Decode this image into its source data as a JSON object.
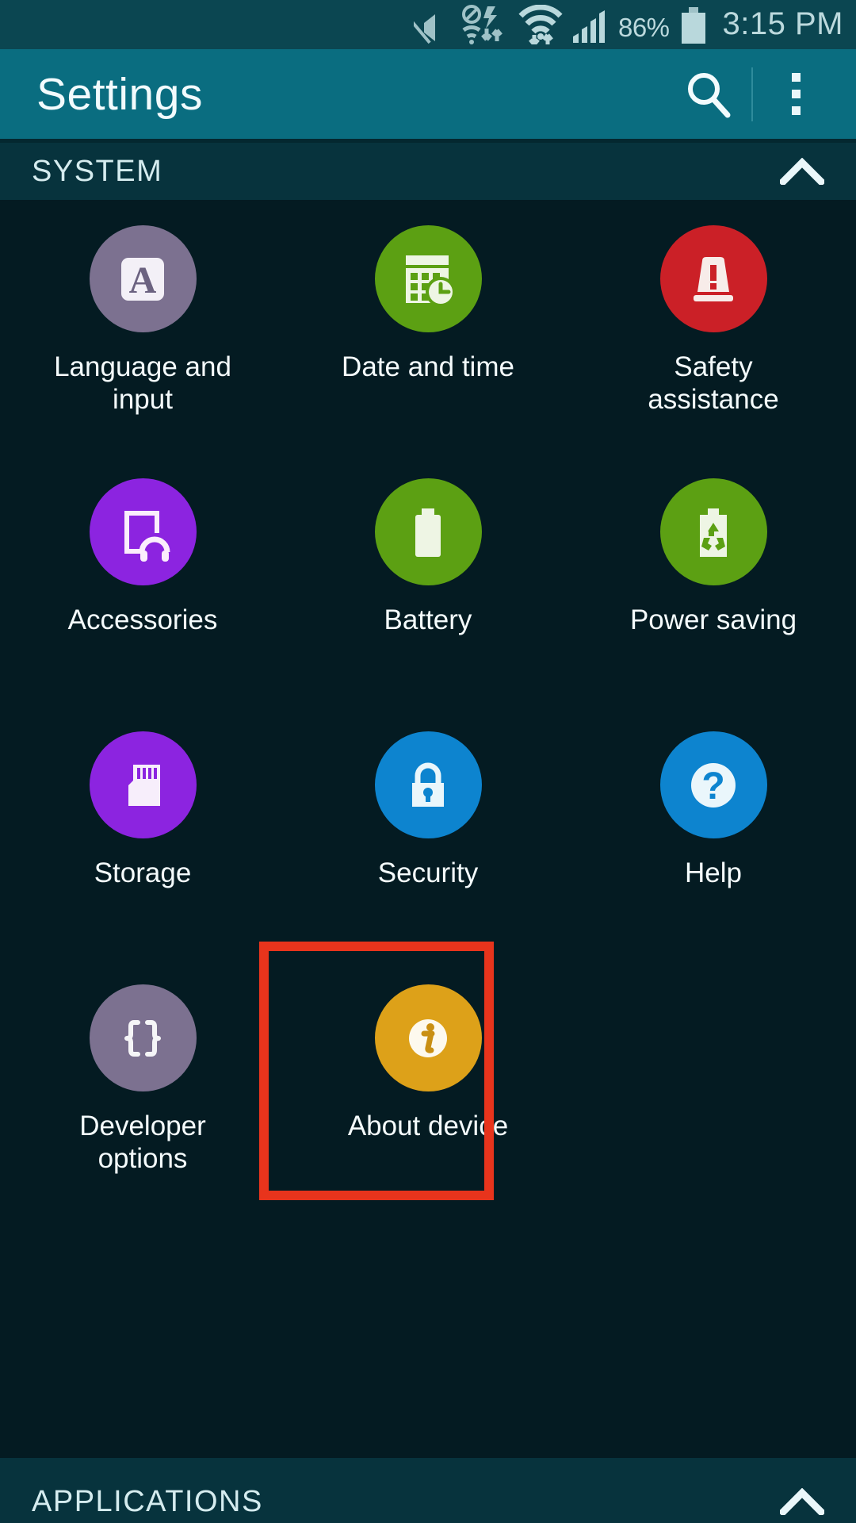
{
  "status_bar": {
    "battery_percent": "86%",
    "time": "3:15 PM",
    "icons": [
      "mute-icon",
      "no-sync-wifi-icon",
      "wifi-icon",
      "signal-bars-icon",
      "battery-icon"
    ]
  },
  "action_bar": {
    "title": "Settings",
    "search_icon": "search-icon",
    "overflow_icon": "overflow-menu-icon"
  },
  "sections": {
    "system": {
      "title": "SYSTEM",
      "collapse_icon": "chevron-up-icon"
    },
    "applications": {
      "title": "APPLICATIONS",
      "collapse_icon": "chevron-up-icon"
    }
  },
  "colors": {
    "status_bar_bg": "#0b4651",
    "action_bar_bg": "#0a6d80",
    "section_header_bg": "#07333d",
    "page_bg": "#041b22",
    "highlight_box": "#e8341c",
    "text_primary": "#f4fbfc"
  },
  "grid_items": [
    {
      "label": "Language and input",
      "icon": "language-input-icon",
      "circle_color": "#7c7190",
      "highlighted": false
    },
    {
      "label": "Date and time",
      "icon": "date-time-icon",
      "circle_color": "#5ca013",
      "highlighted": false
    },
    {
      "label": "Safety assistance",
      "icon": "safety-beacon-icon",
      "circle_color": "#cb2027",
      "highlighted": false
    },
    {
      "label": "Accessories",
      "icon": "accessories-icon",
      "circle_color": "#8c24e0",
      "highlighted": false
    },
    {
      "label": "Battery",
      "icon": "battery-icon",
      "circle_color": "#5ca013",
      "highlighted": false
    },
    {
      "label": "Power saving",
      "icon": "power-saving-icon",
      "circle_color": "#5ca013",
      "highlighted": false
    },
    {
      "label": "Storage",
      "icon": "sd-card-icon",
      "circle_color": "#8c24e0",
      "highlighted": false
    },
    {
      "label": "Security",
      "icon": "lock-icon",
      "circle_color": "#0d84cf",
      "highlighted": false
    },
    {
      "label": "Help",
      "icon": "question-mark-icon",
      "circle_color": "#0d84cf",
      "highlighted": false
    },
    {
      "label": "Developer options",
      "icon": "curly-braces-icon",
      "circle_color": "#7c7190",
      "highlighted": false
    },
    {
      "label": "About device",
      "icon": "info-icon",
      "circle_color": "#dda119",
      "highlighted": true
    }
  ]
}
